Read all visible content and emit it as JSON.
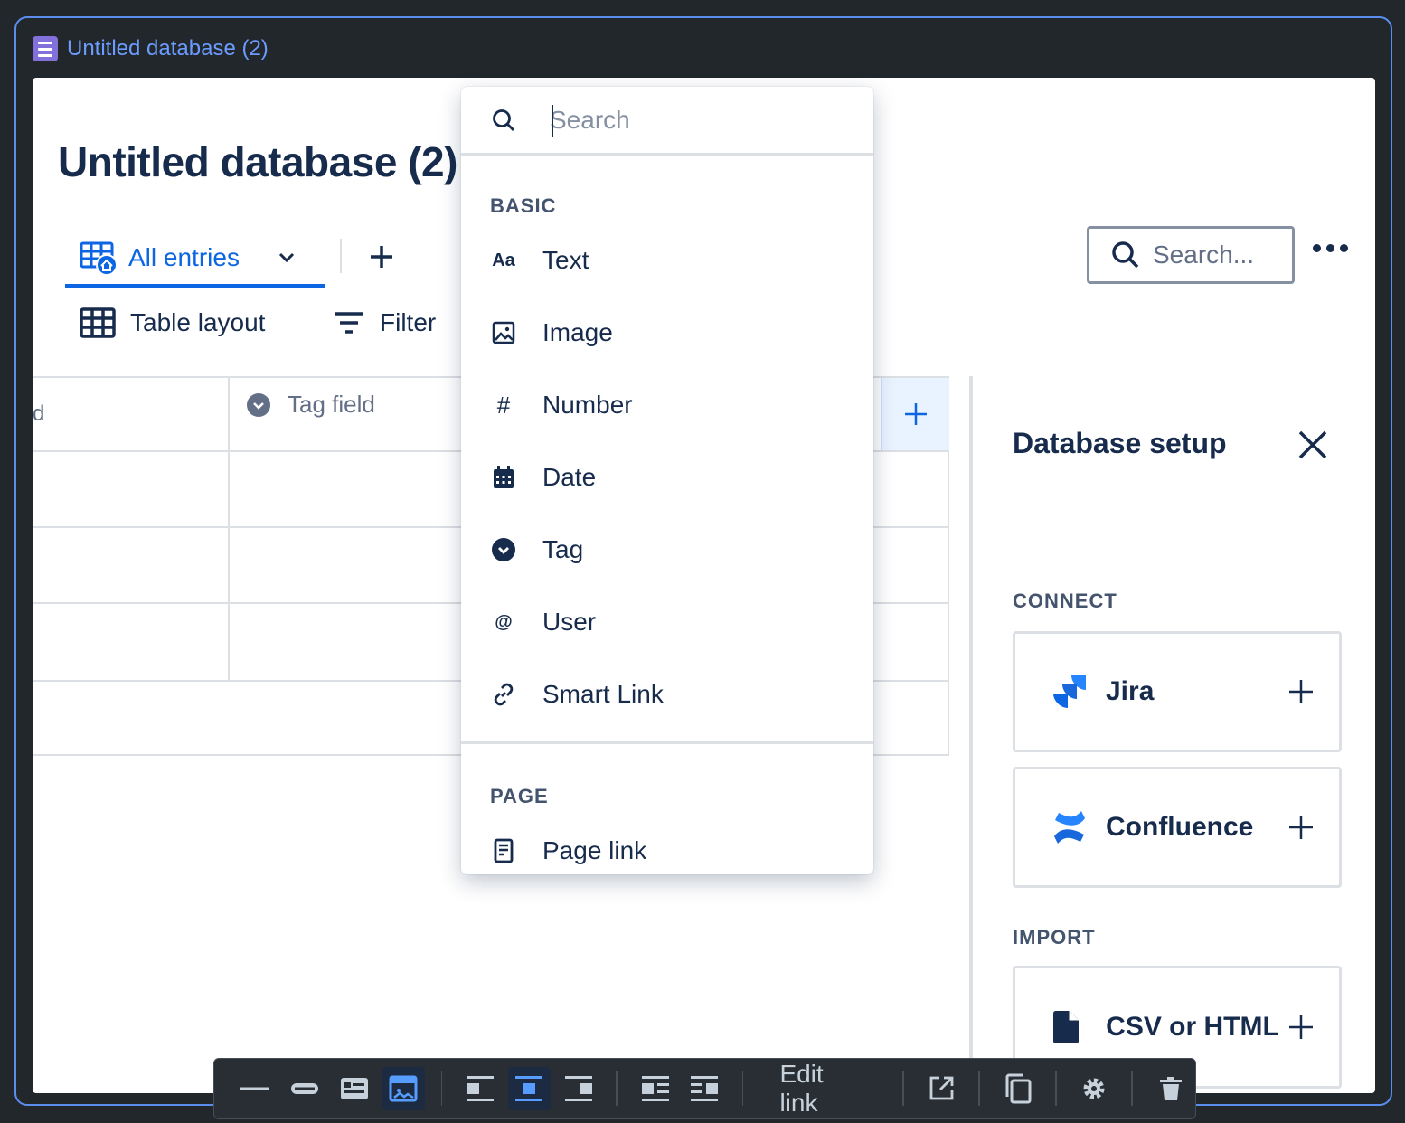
{
  "frame": {
    "title": "Untitled database (2)",
    "icon": "database-icon"
  },
  "database": {
    "title": "Untitled database (2)"
  },
  "views": {
    "active_tab": "All entries",
    "layout_label": "Table layout",
    "filter_label": "Filter"
  },
  "search": {
    "placeholder": "Search..."
  },
  "table": {
    "columns": [
      {
        "label": "d",
        "icon": "text-icon"
      },
      {
        "label": "Tag field",
        "icon": "tag-icon"
      }
    ],
    "rows": 3
  },
  "field_menu": {
    "search_placeholder": "Search",
    "sections": [
      {
        "label": "BASIC",
        "items": [
          {
            "label": "Text",
            "icon": "text-format-icon"
          },
          {
            "label": "Image",
            "icon": "image-icon"
          },
          {
            "label": "Number",
            "icon": "hash-icon"
          },
          {
            "label": "Date",
            "icon": "calendar-icon"
          },
          {
            "label": "Tag",
            "icon": "tag-icon"
          },
          {
            "label": "User",
            "icon": "at-icon"
          },
          {
            "label": "Smart Link",
            "icon": "link-icon"
          }
        ]
      },
      {
        "label": "PAGE",
        "items": [
          {
            "label": "Page link",
            "icon": "page-icon"
          }
        ]
      }
    ]
  },
  "setup_panel": {
    "title": "Database setup",
    "connect_label": "CONNECT",
    "import_label": "IMPORT",
    "connect": [
      {
        "name": "Jira",
        "icon": "jira-icon"
      },
      {
        "name": "Confluence",
        "icon": "confluence-icon"
      }
    ],
    "import": [
      {
        "name": "CSV or HTML",
        "icon": "file-icon"
      }
    ]
  },
  "floating_toolbar": {
    "edit_link_label": "Edit link",
    "colors": {
      "active_bg": "#1c2b41",
      "active_icon": "#579dff"
    }
  },
  "colors": {
    "accent": "#0c66e4",
    "frame_border": "#5b8def",
    "app_bg": "#22272b"
  }
}
